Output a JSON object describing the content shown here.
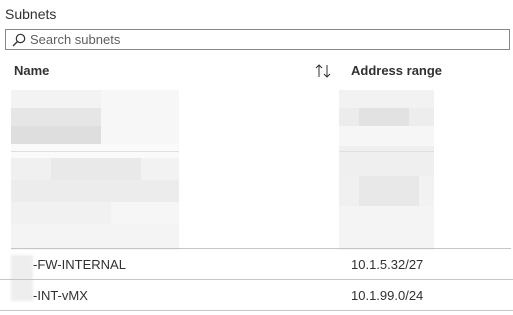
{
  "section": {
    "title": "Subnets"
  },
  "search": {
    "placeholder": "Search subnets",
    "icon": "search-icon"
  },
  "table": {
    "columns": {
      "name": "Name",
      "address": "Address range"
    },
    "sort_icon": "sort-up-down-icon",
    "rows": [
      {
        "name": "-FW-INTERNAL",
        "address": "10.1.5.32/27"
      },
      {
        "name": "-INT-vMX",
        "address": "10.1.99.0/24"
      }
    ]
  }
}
